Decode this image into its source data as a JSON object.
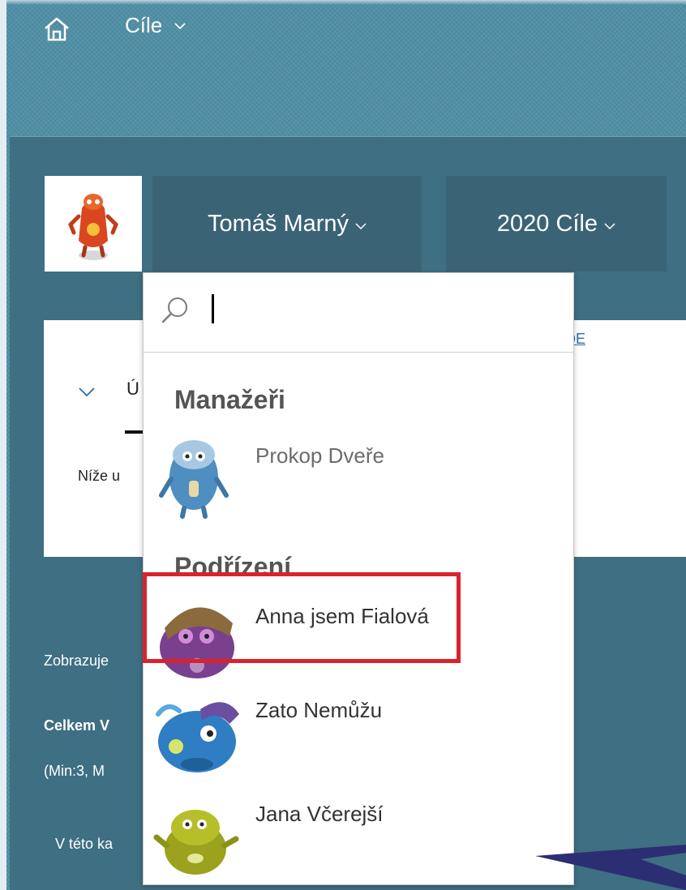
{
  "shell": {
    "title": "Cíle"
  },
  "header": {
    "person_name": "Tomáš Marný",
    "year_label": "2020 Cíle"
  },
  "card": {
    "title_partial": "Ú",
    "text_partial": "Níže u",
    "link_partial": "ZDE"
  },
  "below": {
    "line1": "Zobrazuje",
    "line2": "Celkem V",
    "line3": "(Min:3, M",
    "line4": "V této ka"
  },
  "dropdown": {
    "search_value": "",
    "managers_header": "Manažeři",
    "subordinates_header": "Podřízení",
    "managers": [
      {
        "name": "Prokop Dveře",
        "icon": "blue-creature-avatar-icon"
      }
    ],
    "subordinates": [
      {
        "name": "Anna jsem Fialová",
        "icon": "purple-creature-avatar-icon"
      },
      {
        "name": "Zato Nemůžu",
        "icon": "blue-bird-creature-avatar-icon"
      },
      {
        "name": "Jana Včerejší",
        "icon": "green-creature-avatar-icon"
      }
    ]
  },
  "colors": {
    "background": "#4f8fa6",
    "page": "#3f6f82",
    "button": "#3a6476",
    "highlight": "#d9232c",
    "link": "#2a6ca8"
  }
}
